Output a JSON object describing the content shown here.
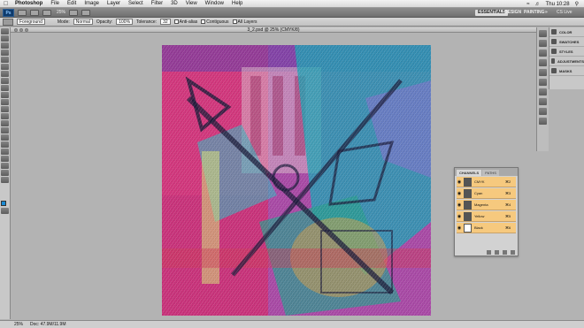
{
  "menubar": {
    "app": "Photoshop",
    "items": [
      "File",
      "Edit",
      "Image",
      "Layer",
      "Select",
      "Filter",
      "3D",
      "View",
      "Window",
      "Help"
    ],
    "clock": "Thu 10:28"
  },
  "appbar": {
    "logo": "Ps",
    "zoom": "25%",
    "workspaces": [
      "ESSENTIALS",
      "DESIGN",
      "PAINTING"
    ],
    "cs_live": "CS Live"
  },
  "options": {
    "sample": "Foreground",
    "mode_label": "Mode:",
    "mode": "Normal",
    "opacity_label": "Opacity:",
    "opacity": "100%",
    "tolerance_label": "Tolerance:",
    "tolerance": "32",
    "antialias": "Anti-alias",
    "contiguous": "Contiguous",
    "all_layers": "All Layers"
  },
  "document": {
    "tab_title": "3_2.psd @ 25% (CMYK/8)"
  },
  "status": {
    "zoom": "25%",
    "doc": "Doc: 47.9M/11.9M"
  },
  "panels": [
    {
      "label": "COLOR",
      "icon": "color-icon"
    },
    {
      "label": "SWATCHES",
      "icon": "swatches-icon"
    },
    {
      "label": "STYLES",
      "icon": "styles-icon"
    },
    {
      "label": "ADJUSTMENTS",
      "icon": "adjustments-icon"
    },
    {
      "label": "MASKS",
      "icon": "masks-icon"
    }
  ],
  "channels_panel": {
    "tabs": [
      "CHANNELS",
      "PATHS"
    ],
    "rows": [
      {
        "name": "CMYK",
        "shortcut": "⌘2"
      },
      {
        "name": "Cyan",
        "shortcut": "⌘3"
      },
      {
        "name": "Magenta",
        "shortcut": "⌘4"
      },
      {
        "name": "Yellow",
        "shortcut": "⌘5"
      },
      {
        "name": "Black",
        "shortcut": "⌘6"
      }
    ]
  },
  "colors": {
    "foreground": "#1a8ad4",
    "background": "#ffffff",
    "channel_highlight": "#f6c97e"
  }
}
